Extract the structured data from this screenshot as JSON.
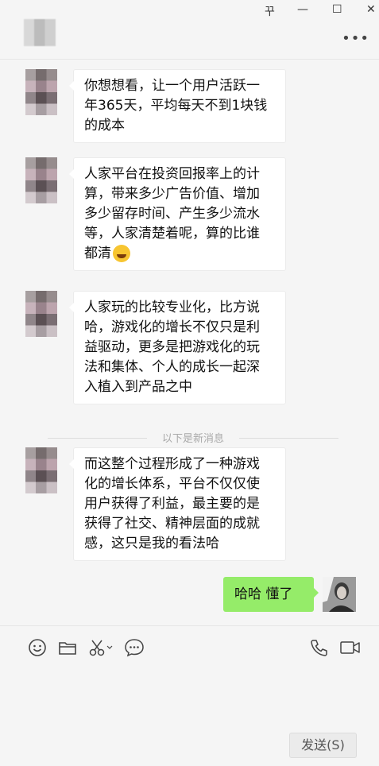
{
  "window": {
    "controls": [
      "꾸",
      "—",
      "☐",
      "✕"
    ],
    "more_label": "•••"
  },
  "messages": [
    {
      "sender": "other",
      "text": "你想想看，让一个用户活跃一年365天，平均每天不到1块钱的成本",
      "lines": [
        "你想想看，让一个用户活跃一",
        "年365天，平均每天不到1块钱",
        "的成本"
      ]
    },
    {
      "sender": "other",
      "lines": [
        "人家平台在投资回报率上的计",
        "算，带来多少广告价值、增加",
        "多少留存时间、产生多少流水",
        "等，人家清楚着呢，算的比谁",
        "都清"
      ],
      "emoji": "laugh-cry-emoji"
    },
    {
      "sender": "other",
      "lines": [
        "人家玩的比较专业化，比方说",
        "哈，游戏化的增长不仅只是利",
        "益驱动，更多是把游戏化的玩",
        "法和集体、个人的成长一起深",
        "入植入到产品之中"
      ]
    },
    {
      "sender": "other",
      "lines": [
        "而这整个过程形成了一种游戏",
        "化的增长体系，平台不仅仅使",
        "用户获得了利益，最主要的是",
        "获得了社交、精神层面的成就",
        "感，这只是我的看法哈"
      ]
    },
    {
      "sender": "me",
      "text": "哈哈  懂了"
    }
  ],
  "new_messages_divider": "以下是新消息",
  "toolbar": {
    "icons": [
      "emoji-icon",
      "folder-icon",
      "scissors-icon",
      "chat-bubble-icon",
      "phone-icon",
      "video-icon"
    ]
  },
  "send_button_label": "发送(S)"
}
